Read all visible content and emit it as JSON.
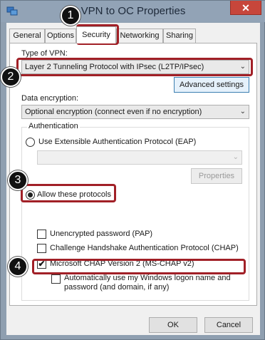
{
  "window": {
    "title": "VPN to OC Properties",
    "close_glyph": "✕"
  },
  "tabs": [
    {
      "label": "General"
    },
    {
      "label": "Options"
    },
    {
      "label": "Security"
    },
    {
      "label": "Networking"
    },
    {
      "label": "Sharing"
    }
  ],
  "active_tab": "Security",
  "vpn_type": {
    "label": "Type of VPN:",
    "value": "Layer 2 Tunneling Protocol with IPsec (L2TP/IPsec)"
  },
  "advanced_settings_label": "Advanced settings",
  "data_encryption": {
    "label": "Data encryption:",
    "value": "Optional encryption (connect even if no encryption)"
  },
  "authentication": {
    "group_label": "Authentication",
    "eap_label": "Use Extensible Authentication Protocol (EAP)",
    "eap_select_value": "",
    "properties_label": "Properties",
    "allow_label": "Allow these protocols",
    "protocols": [
      {
        "label": "Unencrypted password (PAP)",
        "checked": false
      },
      {
        "label": "Challenge Handshake Authentication Protocol (CHAP)",
        "checked": false
      },
      {
        "label": "Microsoft CHAP Version 2 (MS-CHAP v2)",
        "checked": true
      }
    ],
    "auto_logon": {
      "line1": "Automatically use my Windows logon name and",
      "line2": "password (and domain, if any)",
      "checked": false
    }
  },
  "footer": {
    "ok_label": "OK",
    "cancel_label": "Cancel"
  },
  "annotations": [
    {
      "number": "1"
    },
    {
      "number": "2"
    },
    {
      "number": "3"
    },
    {
      "number": "4"
    }
  ],
  "colors": {
    "titlebar": "#92a3b6",
    "close_button": "#c7463b",
    "highlight": "#a12027",
    "step_badge": "#111111"
  },
  "checkmark_glyph": "✔",
  "chevron_glyph": "⌄"
}
